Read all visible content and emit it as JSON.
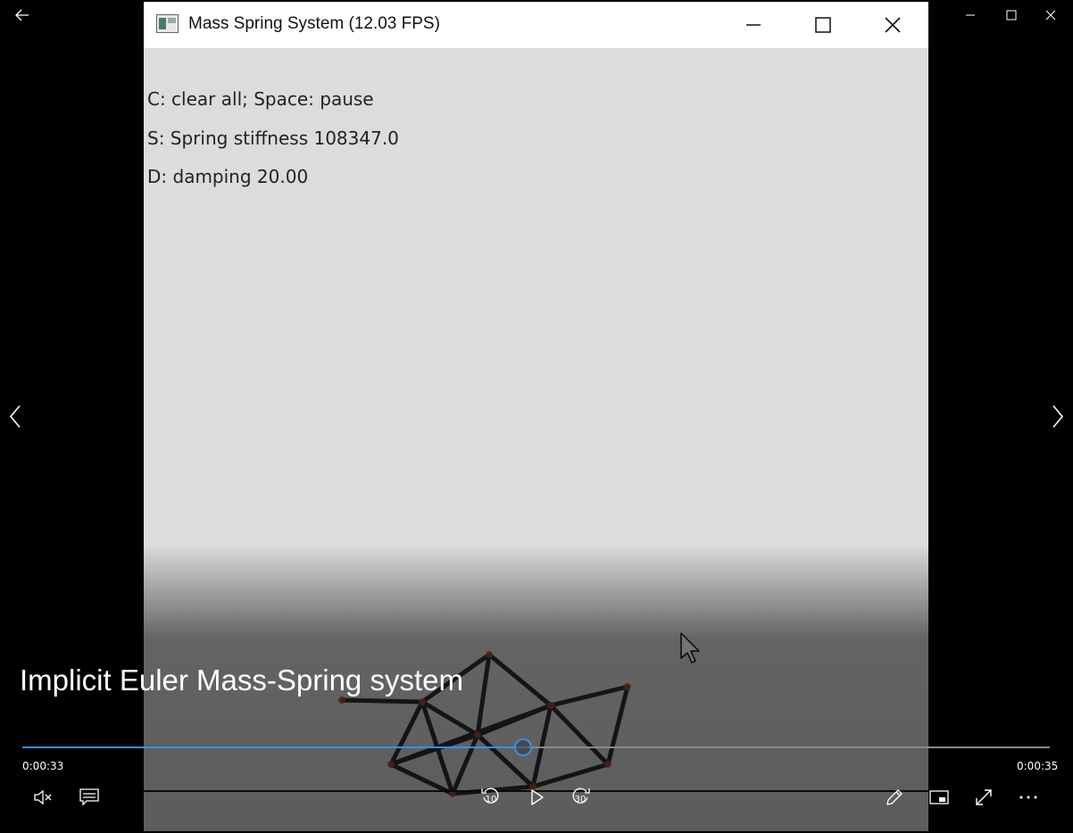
{
  "app_window": {
    "title": "Mass Spring System (12.03 FPS)",
    "help_lines": [
      "C: clear all; Space: pause",
      "S: Spring stiffness 108347.0",
      "D: damping 20.00"
    ],
    "colors": {
      "background": "#dcdcdc",
      "spring": "#2b2f36",
      "mass": "#b0512b"
    }
  },
  "player": {
    "video_title": "Implicit Euler Mass-Spring system",
    "time_current": "0:00:33",
    "time_total": "0:00:35",
    "progress": 0.487,
    "accent_color": "#3a8ee6",
    "skip_back_seconds": "10",
    "skip_forward_seconds": "30",
    "icons": {
      "back": "back-arrow-icon",
      "minimize": "minimize-icon",
      "maximize": "maximize-icon",
      "close": "close-icon",
      "previous": "chevron-left-icon",
      "next": "chevron-right-icon",
      "mute": "volume-muted-icon",
      "captions": "captions-icon",
      "rewind": "skip-back-icon",
      "play": "play-icon",
      "forward": "skip-forward-icon",
      "edit": "pencil-icon",
      "miniview": "mini-view-icon",
      "fullscreen": "fullscreen-icon",
      "more": "more-icon"
    }
  }
}
